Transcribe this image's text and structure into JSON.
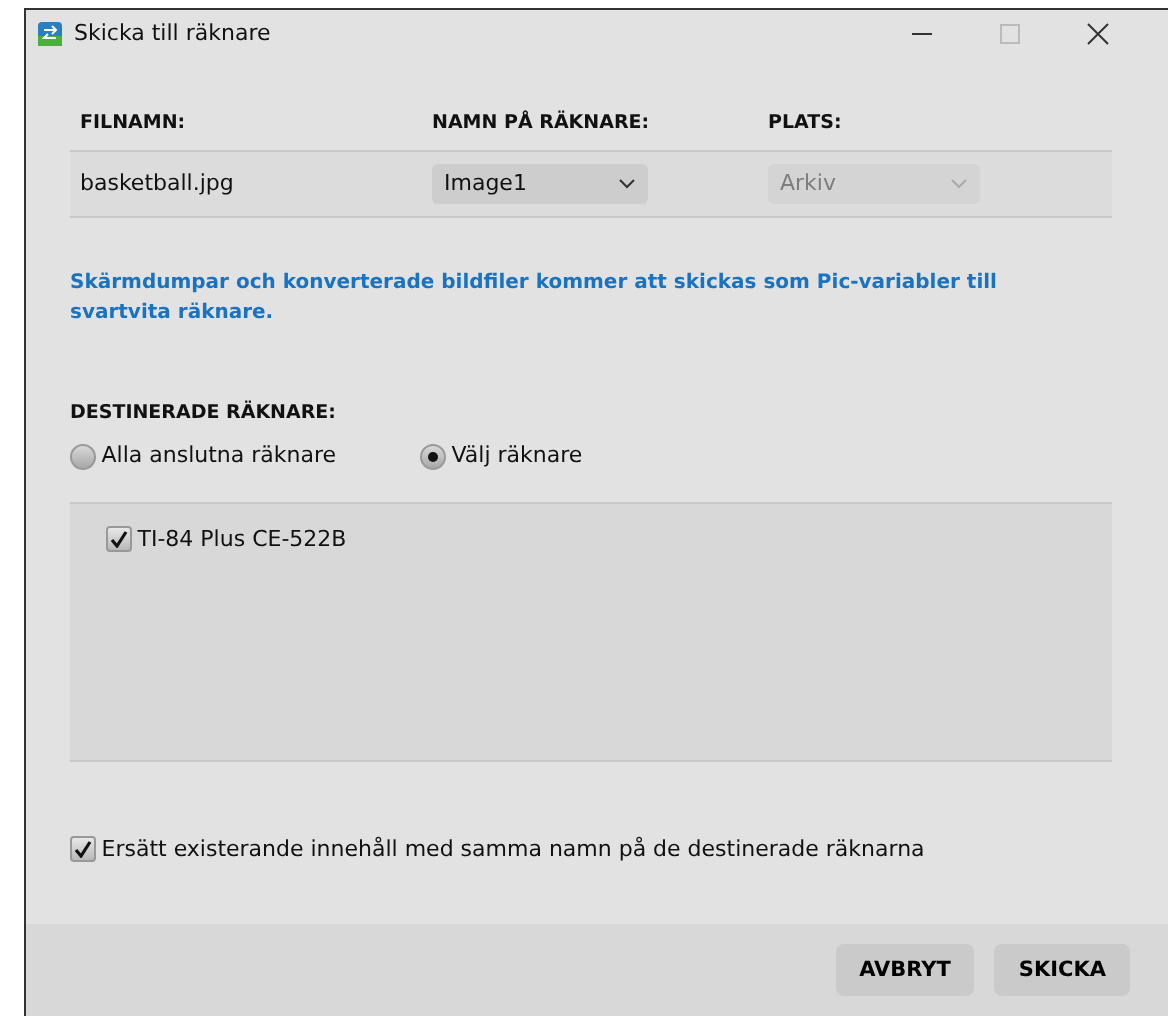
{
  "window": {
    "title": "Skicka till räknare"
  },
  "table": {
    "columns": [
      "FILNAMN:",
      "NAMN PÅ RÄKNARE:",
      "PLATS:"
    ],
    "row": {
      "filename": "basketball.jpg",
      "calc_name": "Image1",
      "location": "Arkiv",
      "location_disabled": true
    }
  },
  "info": "Skärmdumpar och konverterade bildfiler kommer att skickas som Pic-variabler till svartvita räknare.",
  "destinations": {
    "label": "DESTINERADE RÄKNARE:",
    "options": [
      {
        "label": "Alla anslutna räknare",
        "selected": false
      },
      {
        "label": "Välj räknare",
        "selected": true
      }
    ],
    "calculators": [
      {
        "label": "TI-84 Plus CE-522B",
        "checked": true
      }
    ]
  },
  "replace": {
    "label": "Ersätt existerande innehåll med samma namn på de destinerade räknarna",
    "checked": true
  },
  "buttons": [
    "AVBRYT",
    "SKICKA"
  ]
}
